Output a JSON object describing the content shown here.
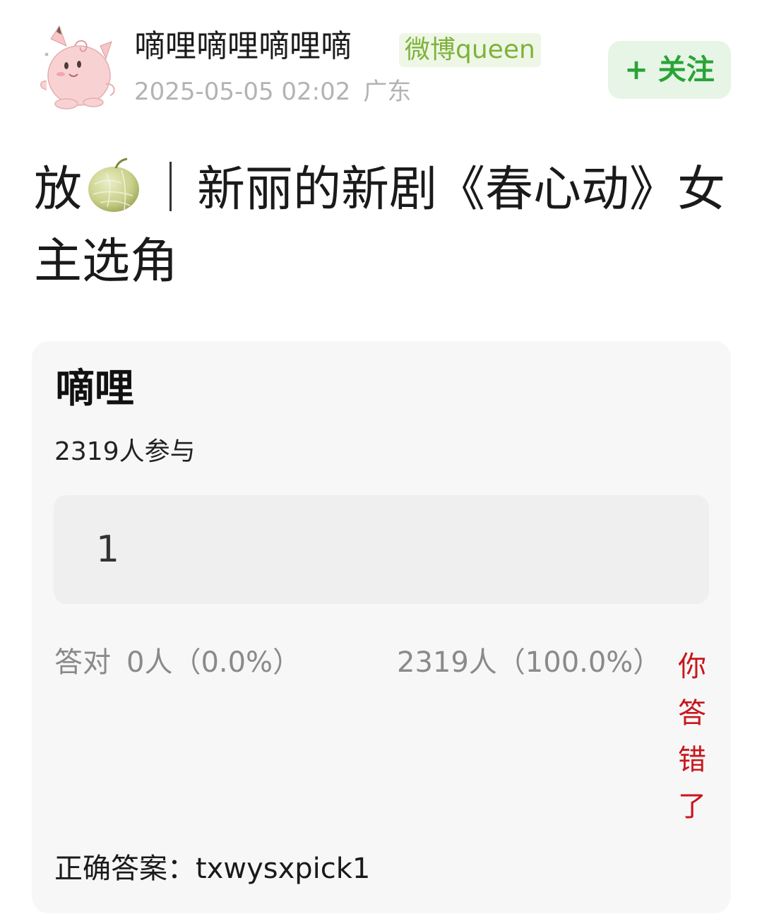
{
  "post": {
    "username": "嘀哩嘀哩嘀哩嘀",
    "badge": "微博queen",
    "timestamp": "2025-05-05 02:02",
    "location": "广东",
    "follow_label": "+ 关注",
    "avatar_icon": "clefairy-avatar-icon",
    "title_prefix": "放",
    "title_emoji_icon": "melon-emoji-icon",
    "title_text": "新丽的新剧《春心动》女主选角"
  },
  "quiz": {
    "title": "嘀哩",
    "participants": "2319人参与",
    "option": "1",
    "correct_label": "答对",
    "correct_count": "0人（0.0%）",
    "wrong_count": "2319人（100.0%）",
    "wrong_verdict": "你答错了",
    "answer_label": "正确答案：",
    "answer_value": "txwysxpick1",
    "verdict_color": "#c8161d"
  },
  "colors": {
    "follow_text": "#2aa336",
    "follow_bg": "#e6f5e6",
    "badge_text": "#7fb23a",
    "badge_bg": "#eef7e6",
    "card_bg": "#f7f7f7"
  }
}
